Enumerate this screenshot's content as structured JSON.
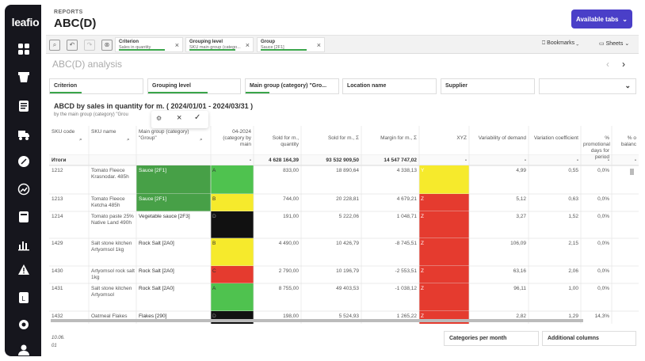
{
  "app": {
    "logo": "leafio",
    "section": "REPORTS",
    "title": "ABC(D)",
    "available_tabs": "Available tabs"
  },
  "colors": {
    "accent": "#4a3fc8",
    "green": "#3aa54a",
    "cell_green": "#4fc24f",
    "cell_yellow": "#f6ea2c",
    "cell_red": "#e53b2f",
    "cell_black": "#111111"
  },
  "sidebar_icons": [
    "grid-icon",
    "cup-icon",
    "list-icon",
    "truck-icon",
    "percent-icon",
    "trend-icon",
    "flag-icon",
    "chart-icon",
    "warning-icon",
    "document-icon",
    "gear-icon",
    "user-icon"
  ],
  "selections": [
    {
      "label": "Criterion",
      "value": "Sales in quantity"
    },
    {
      "label": "Grouping level",
      "value": "SKU main group (catego..."
    },
    {
      "label": "Group",
      "value": "Sauce [2F1]"
    }
  ],
  "toolbar": {
    "bookmarks": "Bookmarks",
    "sheets": "Sheets"
  },
  "sheet_title": "ABC(D) analysis",
  "filters": [
    "Criterion",
    "Grouping level",
    "Main group (category) \"Gro...",
    "Location name",
    "Supplier",
    ""
  ],
  "chart_title": "ABCD by sales in quantity for m. ( 2024/01/01 - 2024/03/31 )",
  "chart_subtitle": "by the main group (category) \"Grou",
  "table": {
    "headers": [
      "SKU code",
      "SKU name",
      "Main group (category) \"Group\"",
      "04-2024 (category by main",
      "Sold for m., quantity",
      "Sold for m., Σ",
      "Margin for m., Σ",
      "XYZ",
      "Variability of demand",
      "Variation coefficient",
      "% promotional days for period",
      "% o balanc"
    ],
    "totals": {
      "label": "Итоги",
      "values": [
        "-",
        "4 628 164,39",
        "93 532 909,50",
        "14 547 747,02",
        "-",
        "-",
        "-",
        "-",
        "-"
      ]
    },
    "rows": [
      {
        "code": "1212",
        "name": "Tomato Fleece Krasnodar. 485h",
        "group": "Sauce [2F1]",
        "cat": "A",
        "qty": "833,00",
        "sold": "18 890,64",
        "margin": "4 338,13",
        "xyz": "Y",
        "var": "4,99",
        "coef": "0,55",
        "promo": "0,0%"
      },
      {
        "code": "1213",
        "name": "Tomato Fleece Ketcha 485h",
        "group": "Sauce [2F1]",
        "cat": "B",
        "qty": "744,00",
        "sold": "20 228,81",
        "margin": "4 679,21",
        "xyz": "Z",
        "var": "5,12",
        "coef": "0,63",
        "promo": "0,0%"
      },
      {
        "code": "1214",
        "name": "Tomato paste 25% Native Land 490h",
        "group": "Vegetable sauce [2F3]",
        "cat": "D",
        "qty": "191,00",
        "sold": "5 222,06",
        "margin": "1 048,71",
        "xyz": "Z",
        "var": "3,27",
        "coef": "1,52",
        "promo": "0,0%"
      },
      {
        "code": "1429",
        "name": "Salt stone kitchen Artyomsol 1kg",
        "group": "Rock Salt [2A0]",
        "cat": "B",
        "qty": "4 490,00",
        "sold": "10 426,79",
        "margin": "-8 745,51",
        "xyz": "Z",
        "var": "106,09",
        "coef": "2,15",
        "promo": "0,0%"
      },
      {
        "code": "1430",
        "name": "Artyomsol rock salt 1kg",
        "group": "Rock Salt [2A0]",
        "cat": "C",
        "qty": "2 790,00",
        "sold": "10 196,79",
        "margin": "-2 553,51",
        "xyz": "Z",
        "var": "63,16",
        "coef": "2,06",
        "promo": "0,0%"
      },
      {
        "code": "1431",
        "name": "Salt stone kitchen Artyomsol",
        "group": "Rock Salt [2A0]",
        "cat": "A",
        "qty": "8 755,00",
        "sold": "49 403,53",
        "margin": "-1 038,12",
        "xyz": "Z",
        "var": "96,11",
        "coef": "1,00",
        "promo": "0,0%"
      },
      {
        "code": "1432",
        "name": "Oatmeal Flakes",
        "group": "Flakes [290]",
        "cat": "D",
        "qty": "198,00",
        "sold": "5 524,93",
        "margin": "1 265,22",
        "xyz": "Z",
        "var": "2,82",
        "coef": "1,29",
        "promo": "14,3%"
      }
    ]
  },
  "bottom": {
    "categories_btn": "Categories per month",
    "columns_btn": "Additional columns",
    "meta1": "10.06.",
    "meta2": "01"
  }
}
